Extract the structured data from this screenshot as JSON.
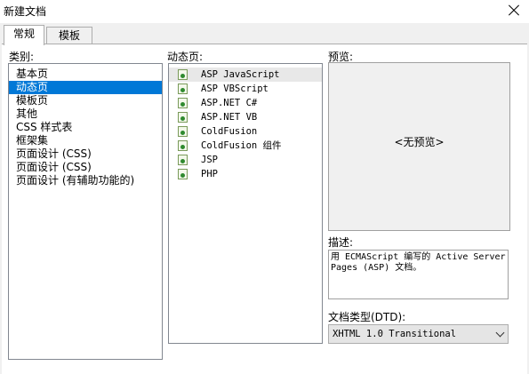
{
  "window": {
    "title": "新建文档"
  },
  "tabs": [
    {
      "label": "常规"
    },
    {
      "label": "模板"
    }
  ],
  "category": {
    "label": "类别:",
    "items": [
      {
        "label": "基本页"
      },
      {
        "label": "动态页"
      },
      {
        "label": "模板页"
      },
      {
        "label": "其他"
      },
      {
        "label": "CSS 样式表"
      },
      {
        "label": "框架集"
      },
      {
        "label": "页面设计 (CSS)"
      },
      {
        "label": "页面设计 (CSS)"
      },
      {
        "label": "页面设计 (有辅助功能的)"
      }
    ],
    "selected_index": 1
  },
  "dynamic": {
    "label": "动态页:",
    "items": [
      {
        "label": "ASP JavaScript"
      },
      {
        "label": "ASP VBScript"
      },
      {
        "label": "ASP.NET C#"
      },
      {
        "label": "ASP.NET VB"
      },
      {
        "label": "ColdFusion"
      },
      {
        "label": "ColdFusion 组件"
      },
      {
        "label": "JSP"
      },
      {
        "label": "PHP"
      }
    ],
    "selected_index": 0
  },
  "preview": {
    "label": "预览:",
    "placeholder": "<无预览>"
  },
  "description": {
    "label": "描述:",
    "text": "用 ECMAScript 编写的 Active Server Pages (ASP) 文档。"
  },
  "doctype": {
    "label": "文档类型(DTD):",
    "value": "XHTML 1.0 Transitional"
  }
}
